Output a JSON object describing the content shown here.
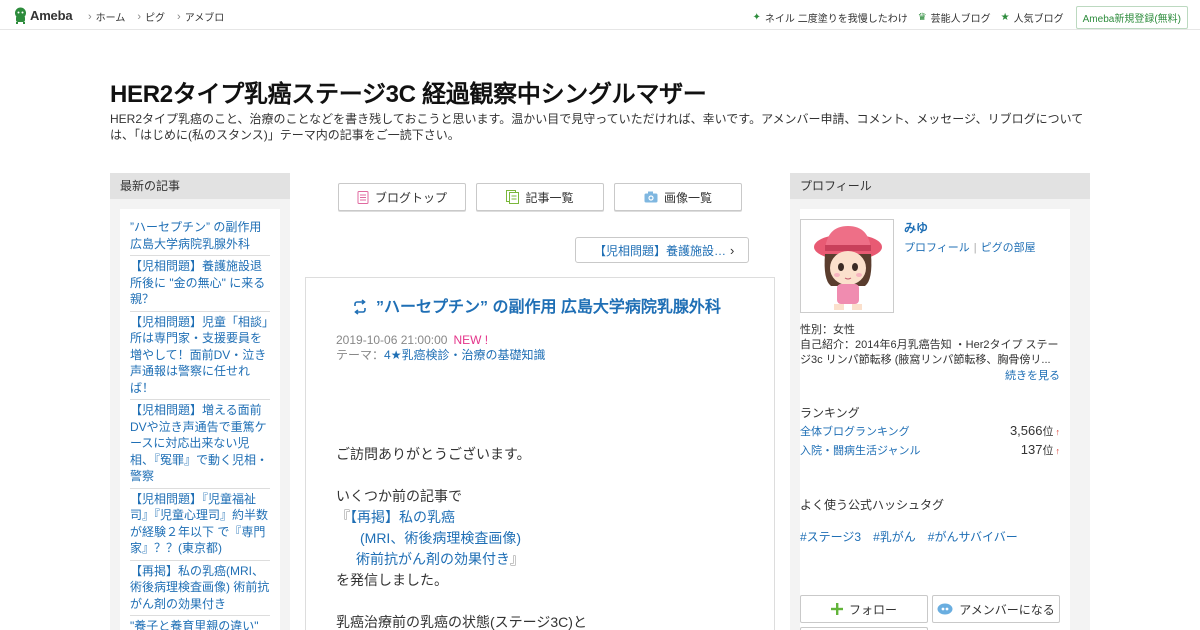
{
  "global_header": {
    "logo_text": "Ameba",
    "nav": [
      "ホーム",
      "ピグ",
      "アメブロ"
    ],
    "right_links": [
      {
        "icon": "diamond-icon",
        "label": "ネイル 二度塗りを我慢したわけ"
      },
      {
        "icon": "crown-icon",
        "label": "芸能人ブログ"
      },
      {
        "icon": "star-icon",
        "label": "人気ブログ"
      }
    ],
    "register_label": "Ameba新規登録(無料)"
  },
  "blog": {
    "title": "HER2タイプ乳癌ステージ3C 経過観察中シングルマザー",
    "description": "HER2タイプ乳癌のこと、治療のことなどを書き残しておこうと思います。温かい目で見守っていただければ、幸いです。アメンバー申請、コメント、メッセージ、リブログについては、「はじめに(私のスタンス)」テーマ内の記事をご一読下さい。"
  },
  "recent": {
    "heading": "最新の記事",
    "items": [
      "”ハーセプチン” の副作用 広島大学病院乳腺外科",
      "【児相問題】養護施設退所後に \"金の無心\" に来る親？",
      "【児相問題】児童「相談」所は専門家・支援要員を増やして！面前DV・泣き声通報は警察に任せれば！",
      "【児相問題】増える面前DVや泣き声通告で重篤ケースに対応出来ない児相、『冤罪』で動く児相・警察",
      "【児相問題】『児童福祉司』『児童心理司』約半数が経験２年以下 で『専門家』？？(東京都)",
      "【再掲】私の乳癌(MRI、術後病理検査画像) 術前抗がん剤の効果付き",
      "\"養子と養育里親の違い\""
    ]
  },
  "tabs": [
    {
      "icon": "document-icon",
      "label": "ブログトップ"
    },
    {
      "icon": "list-icon",
      "label": "記事一覧"
    },
    {
      "icon": "camera-icon",
      "label": "画像一覧"
    }
  ],
  "prev_article_label": "【児相問題】養護施設…",
  "article": {
    "title": "”ハーセプチン” の副作用 広島大学病院乳腺外科",
    "date": "2019-10-06 21:00:00",
    "new_badge": "NEW !",
    "theme_prefix": "テーマ：",
    "theme": "4★乳癌検診・治療の基礎知識",
    "body": {
      "greeting": "ご訪問ありがとうございます。",
      "line1": "いくつか前の記事で",
      "quote_open": "『",
      "link_line1": "【再掲】私の乳癌",
      "link_line2": "(MRI、術後病理検査画像)",
      "link_line3": "術前抗がん剤の効果付き",
      "quote_close": "』",
      "line2": "を発信しました。",
      "line3": "乳癌治療前の乳癌の状態(ステージ3C)と"
    }
  },
  "profile": {
    "heading": "プロフィール",
    "name": "みゆ",
    "link_profile": "プロフィール",
    "link_separator": "|",
    "link_pig": "ピグの部屋",
    "gender": "性別：女性",
    "intro": "自己紹介：2014年6月乳癌告知 ・Her2タイプ ステージ3c リンパ節転移 (腋窩リンパ節転移、胸骨傍リ...",
    "more_label": "続きを見る",
    "ranking_heading": "ランキング",
    "rankings": [
      {
        "name": "全体ブログランキング",
        "value": "3,566",
        "unit": "位",
        "trend": "↑"
      },
      {
        "name": "入院・闘病生活ジャンル",
        "value": "137",
        "unit": "位",
        "trend": "↑"
      }
    ],
    "hashtag_heading": "よく使う公式ハッシュタグ",
    "hashtags": [
      "#ステージ3",
      "#乳がん",
      "#がんサバイバー"
    ],
    "follow_label": "フォロー",
    "member_label": "アメンバーになる"
  },
  "colors": {
    "link": "#1f6fb5",
    "brand_green": "#2d8c3c",
    "new_pink": "#e4348a",
    "rank_up_red": "#d9342b"
  }
}
